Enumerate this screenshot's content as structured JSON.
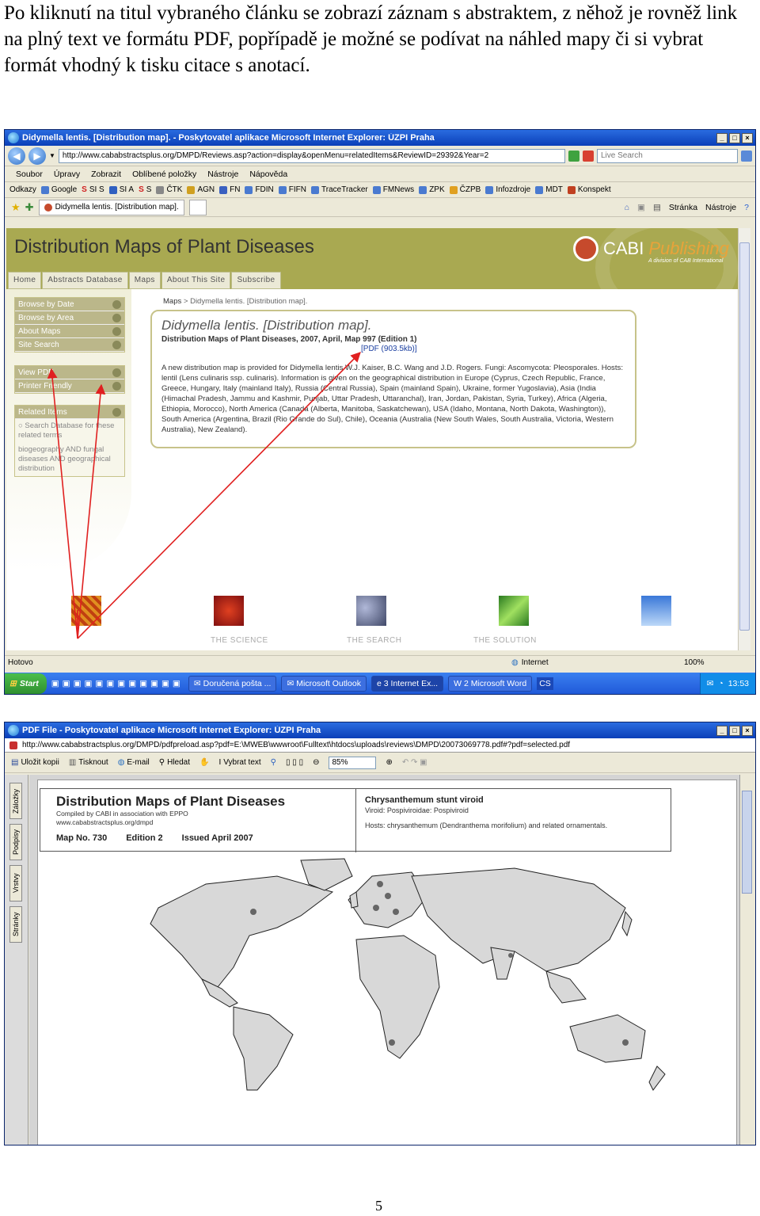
{
  "intro_text": "Po kliknutí na titul vybraného článku se zobrazí záznam s abstraktem, z něhož je rovněž link na plný text ve formátu PDF, popřípadě je možné se podívat na náhled mapy či si vybrat formát vhodný k tisku citace s anotací.",
  "browser": {
    "title": "Didymella lentis. [Distribution map]. - Poskytovatel aplikace Microsoft Internet Explorer: ÚZPI Praha",
    "address": "http://www.cababstractsplus.org/DMPD/Reviews.asp?action=display&openMenu=relatedItems&ReviewID=29392&Year=2",
    "search_placeholder": "Live Search",
    "menu": [
      "Soubor",
      "Úpravy",
      "Zobrazit",
      "Oblíbené položky",
      "Nástroje",
      "Nápověda"
    ],
    "links": [
      "Odkazy",
      "Google",
      "SI S",
      "SI A",
      "S",
      "ČTK",
      "AGN",
      "FN",
      "FDIN",
      "FIFN",
      "TraceTracker",
      "FMNews",
      "ZPK",
      "ČZPB",
      "Infozdroje",
      "MDT",
      "Konspekt"
    ],
    "tab_title": "Didymella lentis. [Distribution map].",
    "tab_tools": [
      "Stránka",
      "Nástroje"
    ]
  },
  "site": {
    "title": "Distribution Maps of Plant Diseases",
    "logo_text": "CABI",
    "logo_accent": "Publishing",
    "logo_sub": "A division of CAB International",
    "nav": [
      "Home",
      "Abstracts Database",
      "Maps",
      "About This Site",
      "Subscribe"
    ],
    "sidebar_group1": [
      "Browse by Date",
      "Browse by Area",
      "About Maps",
      "Site Search"
    ],
    "sidebar_group2": [
      "View PDF",
      "Printer Friendly"
    ],
    "related_heading": "Related Items",
    "related_search": "Search Database for these related terms",
    "related_terms": "biogeography AND fungal diseases AND geographical distribution",
    "breadcrumb_root": "Maps",
    "breadcrumb_sep": ">",
    "breadcrumb_current": "Didymella lentis. [Distribution map].",
    "abstract_title": "Didymella lentis. [Distribution map].",
    "abstract_source": "Distribution Maps of Plant Diseases, 2007, April, Map 997 (Edition 1)",
    "abstract_pdf": "[PDF (903.5kb)]",
    "abstract_body": "A new distribution map is provided for Didymella lentis W.J. Kaiser, B.C. Wang and J.D. Rogers. Fungi: Ascomycota: Pleosporales. Hosts: lentil (Lens culinaris ssp. culinaris). Information is given on the geographical distribution in Europe (Cyprus, Czech Republic, France, Greece, Hungary, Italy (mainland Italy), Russia (Central Russia), Spain (mainland Spain), Ukraine, former Yugoslavia), Asia (India (Himachal Pradesh, Jammu and Kashmir, Punjab, Uttar Pradesh, Uttaranchal), Iran, Jordan, Pakistan, Syria, Turkey), Africa (Algeria, Ethiopia, Morocco), North America (Canada (Alberta, Manitoba, Saskatchewan), USA (Idaho, Montana, North Dakota, Washington)), South America (Argentina, Brazil (Rio Grande do Sul), Chile), Oceania (Australia (New South Wales, South Australia, Victoria, Western Australia), New Zealand).",
    "thumb_labels": [
      "THE SCIENCE",
      "THE SEARCH",
      "THE SOLUTION"
    ]
  },
  "status": {
    "left": "Hotovo",
    "zone": "Internet",
    "zoom": "100%"
  },
  "taskbar": {
    "start": "Start",
    "tasks": [
      "Doručená pošta ...",
      "Microsoft Outlook",
      "3 Internet Ex...",
      "2 Microsoft Word"
    ],
    "tray_label": "CS",
    "clock": "13:53"
  },
  "pdf_window": {
    "title": "PDF File - Poskytovatel aplikace Microsoft Internet Explorer: ÚZPI Praha",
    "address": "http://www.cababstractsplus.org/DMPD/pdfpreload.asp?pdf=E:\\MWEB\\wwwroot\\Fulltext\\htdocs\\uploads\\reviews\\DMPD\\20073069778.pdf#?pdf=selected.pdf",
    "toolbar": [
      "Uložit kopii",
      "Tisknout",
      "E-mail",
      "Hledat",
      "Vybrat text"
    ],
    "zoom": "85%",
    "side_tabs": [
      "Záložky",
      "Podpisy",
      "Vrstvy",
      "Stránky"
    ]
  },
  "map_doc": {
    "title": "Distribution Maps of Plant Diseases",
    "compiled": "Compiled by CABI in association with EPPO",
    "url": "www.cababstractsplus.org/dmpd",
    "map_no": "Map No. 730",
    "edition": "Edition 2",
    "issued": "Issued April 2007",
    "virus_title": "Chrysanthemum stunt viroid",
    "viroid_line": "Viroid: Pospiviroidae: Pospiviroid",
    "hosts_line": "Hosts: chrysanthemum (Dendranthema morifolium) and related ornamentals."
  },
  "page_number": "5",
  "colors": {
    "site_header": "#a9a951",
    "arrow": "#e02020",
    "xp_blue": "#0a3fb8"
  }
}
